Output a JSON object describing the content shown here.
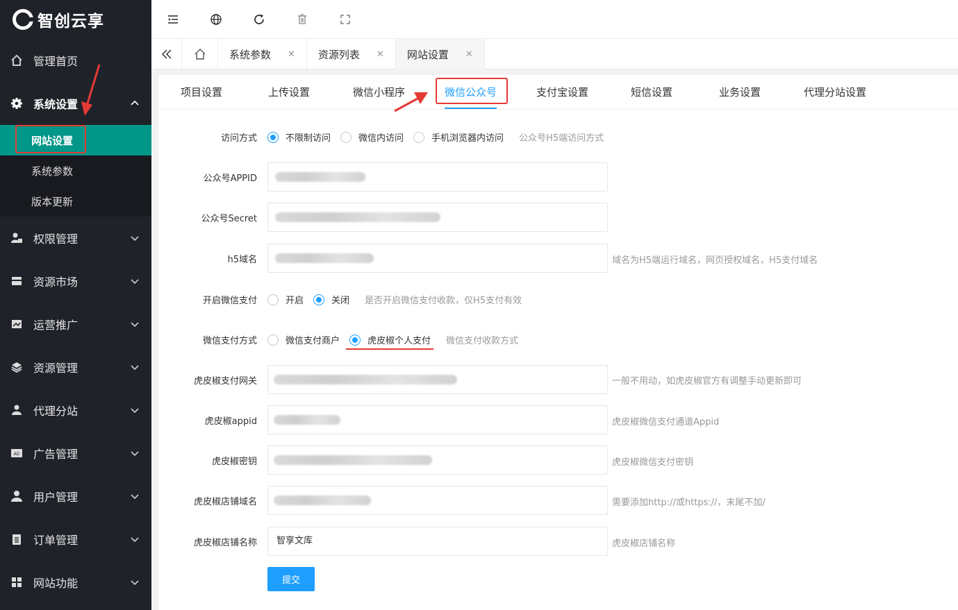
{
  "app": {
    "logo_text": "智创云享"
  },
  "sidebar": {
    "items": [
      {
        "label": "管理首页",
        "icon": "home-icon"
      },
      {
        "label": "系统设置",
        "icon": "gear-icon",
        "expanded": true,
        "children": [
          {
            "label": "网站设置",
            "active": true
          },
          {
            "label": "系统参数"
          },
          {
            "label": "版本更新"
          }
        ]
      },
      {
        "label": "权限管理",
        "icon": "user-lock-icon"
      },
      {
        "label": "资源市场",
        "icon": "storefront-icon"
      },
      {
        "label": "运营推广",
        "icon": "image-icon"
      },
      {
        "label": "资源管理",
        "icon": "layers-icon"
      },
      {
        "label": "代理分站",
        "icon": "group-icon"
      },
      {
        "label": "广告管理",
        "icon": "ad-icon"
      },
      {
        "label": "用户管理",
        "icon": "user-icon"
      },
      {
        "label": "订单管理",
        "icon": "clipboard-icon"
      },
      {
        "label": "网站功能",
        "icon": "grid-icon"
      }
    ]
  },
  "header": {
    "tools": [
      "menu-fold-icon",
      "globe-icon",
      "refresh-icon",
      "trash-icon",
      "fullscreen-icon"
    ]
  },
  "page_tabs": [
    {
      "label": "系统参数",
      "active": false
    },
    {
      "label": "资源列表",
      "active": false
    },
    {
      "label": "网站设置",
      "active": true
    }
  ],
  "sub_tabs": [
    {
      "label": "项目设置"
    },
    {
      "label": "上传设置"
    },
    {
      "label": "微信小程序"
    },
    {
      "label": "微信公众号",
      "active": true
    },
    {
      "label": "支付宝设置"
    },
    {
      "label": "短信设置"
    },
    {
      "label": "业务设置"
    },
    {
      "label": "代理分站设置"
    }
  ],
  "form": {
    "access": {
      "label": "访问方式",
      "options": [
        "不限制访问",
        "微信内访问",
        "手机浏览器内访问"
      ],
      "selected": "不限制访问",
      "hint": "公众号H5端访问方式"
    },
    "appid": {
      "label": "公众号APPID",
      "value": ""
    },
    "secret": {
      "label": "公众号Secret",
      "value": ""
    },
    "h5_domain": {
      "label": "h5域名",
      "value": "",
      "hint": "域名为H5端运行域名，网页授权域名，H5支付域名"
    },
    "wx_pay": {
      "label": "开启微信支付",
      "options": [
        "开启",
        "关闭"
      ],
      "selected": "关闭",
      "hint": "是否开启微信支付收款，仅H5支付有效"
    },
    "pay_method": {
      "label": "微信支付方式",
      "options": [
        "微信支付商户",
        "虎皮椒个人支付"
      ],
      "selected": "虎皮椒个人支付",
      "hint": "微信支付收款方式"
    },
    "xunhu_gateway": {
      "label": "虎皮椒支付网关",
      "value": "",
      "hint": "一般不用动，如虎皮椒官方有调整手动更新即可"
    },
    "xunhu_appid": {
      "label": "虎皮椒appid",
      "value": "",
      "hint": "虎皮椒微信支付通道Appid"
    },
    "xunhu_secret": {
      "label": "虎皮椒密钥",
      "value": "",
      "hint": "虎皮椒微信支付密钥"
    },
    "xunhu_domain": {
      "label": "虎皮椒店铺域名",
      "value": "",
      "hint": "需要添加http://或https://，末尾不加/"
    },
    "xunhu_shop": {
      "label": "虎皮椒店铺名称",
      "value": "智享文库",
      "hint": "虎皮椒店铺名称"
    },
    "submit_label": "提交"
  },
  "colors": {
    "accent": "#1e9fff",
    "sidebar_active": "#009688",
    "annotation": "#e53935"
  }
}
